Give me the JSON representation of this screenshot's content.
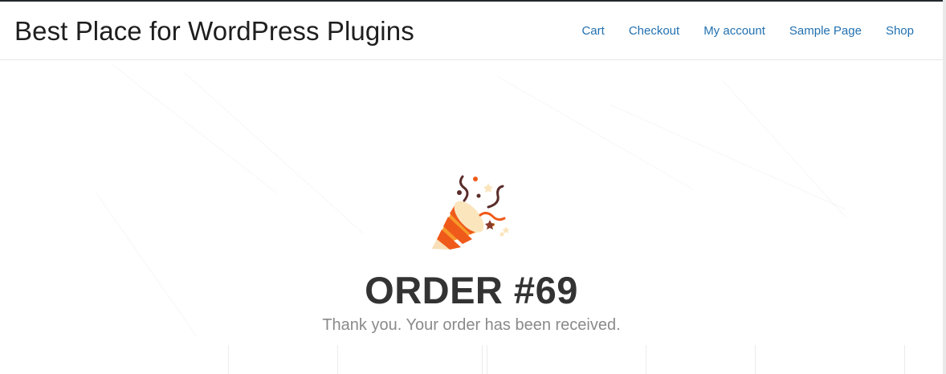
{
  "header": {
    "site_title": "Best Place for WordPress Plugins",
    "nav": [
      {
        "label": "Cart"
      },
      {
        "label": "Checkout"
      },
      {
        "label": "My account"
      },
      {
        "label": "Sample Page"
      },
      {
        "label": "Shop"
      }
    ],
    "link_color": "#2271b1"
  },
  "order": {
    "title": "ORDER #69",
    "subtitle": "Thank you. Your order has been received.",
    "icon": "party-popper-icon"
  }
}
